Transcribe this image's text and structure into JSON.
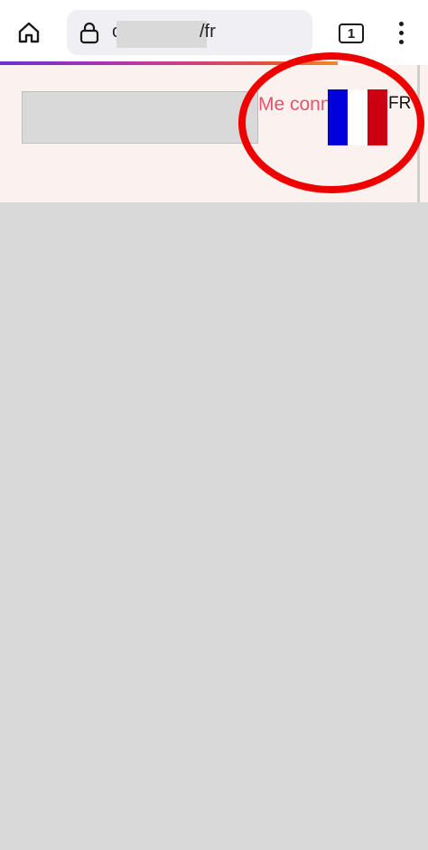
{
  "browser": {
    "url_prefix": "c",
    "url_suffix": "/fr",
    "tab_count": "1",
    "load_progress": 0.79,
    "icons": {
      "home": "home-icon",
      "lock": "lock-icon",
      "tabs": "tabs-icon",
      "menu": "more-vertical-icon"
    }
  },
  "header": {
    "login_label": "Me connecter",
    "language_flag": "france-flag-icon",
    "language_code": "FR"
  },
  "colors": {
    "login_link": "#e8526a",
    "header_bg": "#fbf1ef",
    "annotation": "#ee0000",
    "flag_blue": "#0000dd",
    "flag_red": "#cc0011"
  }
}
